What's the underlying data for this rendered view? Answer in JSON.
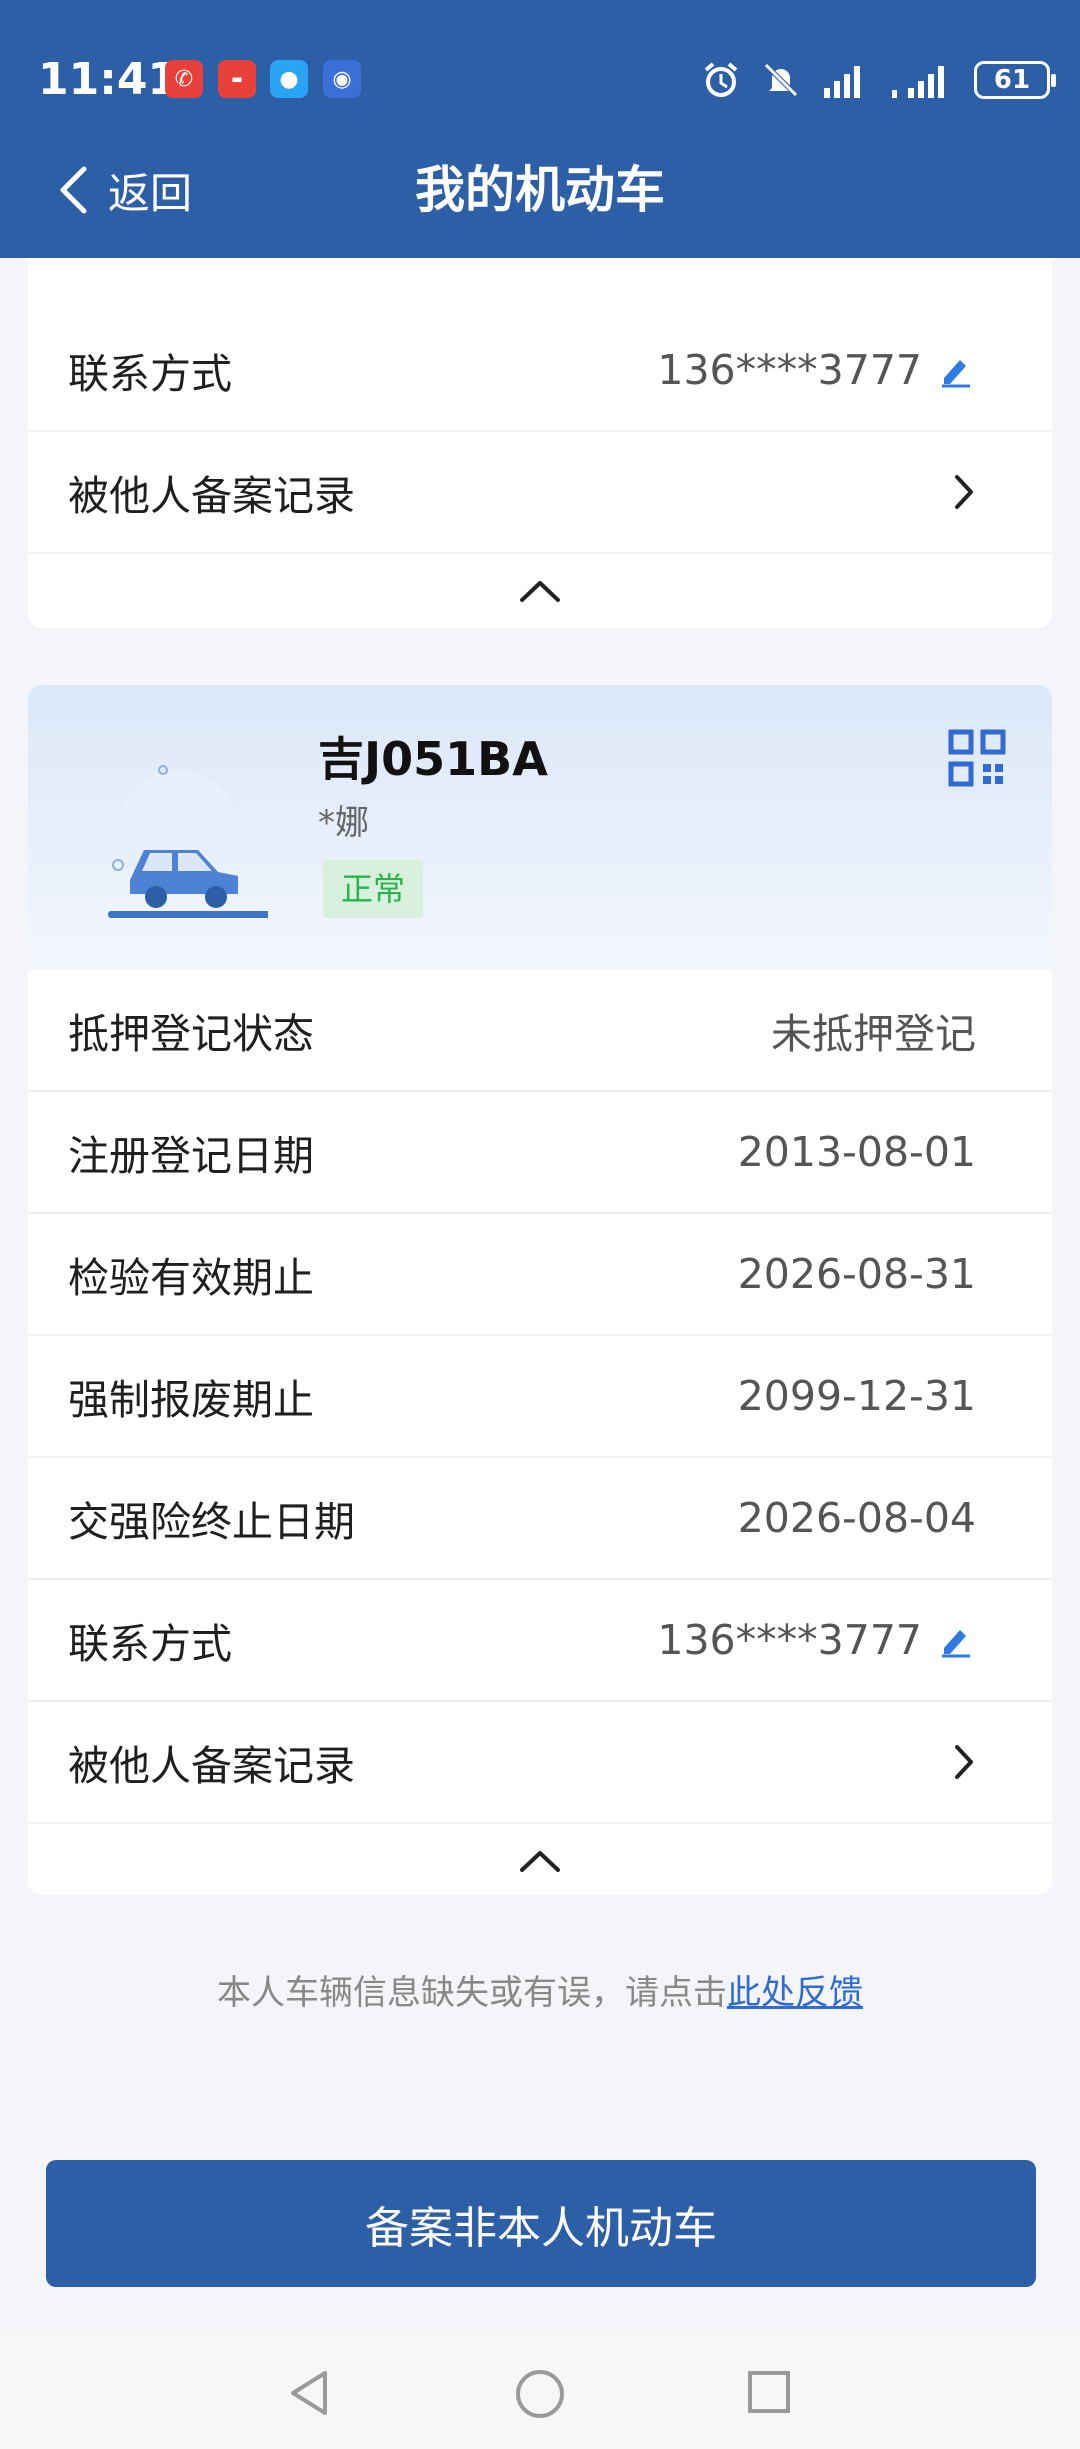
{
  "status_bar": {
    "time": "11:41",
    "battery": "61",
    "notif_icons": [
      "phone-missed-icon",
      "huawei-app-icon",
      "message-icon",
      "app-icon"
    ],
    "right_icons": [
      "alarm-icon",
      "mute-icon",
      "signal-icon",
      "signal-icon-2",
      "battery-icon"
    ]
  },
  "nav": {
    "back_label": "返回",
    "title": "我的机动车"
  },
  "card1": {
    "rows": [
      {
        "label": "联系方式",
        "value": "136****3777"
      },
      {
        "label": "被他人备案记录",
        "value": ""
      }
    ]
  },
  "vehicle": {
    "plate": "吉J051BA",
    "owner": "*娜",
    "status": "正常",
    "rows": [
      {
        "label": "抵押登记状态",
        "value": "未抵押登记"
      },
      {
        "label": "注册登记日期",
        "value": "2013-08-01"
      },
      {
        "label": "检验有效期止",
        "value": "2026-08-31"
      },
      {
        "label": "强制报废期止",
        "value": "2099-12-31"
      },
      {
        "label": "交强险终止日期",
        "value": "2026-08-04"
      },
      {
        "label": "联系方式",
        "value": "136****3777"
      },
      {
        "label": "被他人备案记录",
        "value": ""
      }
    ]
  },
  "feedback": {
    "text": "本人车辆信息缺失或有误，请点击",
    "link": "此处反馈"
  },
  "primary_button": "备案非本人机动车",
  "colors": {
    "brand": "#2d5fa6",
    "status_green": "#2bb24c",
    "link": "#2f6bd3"
  }
}
